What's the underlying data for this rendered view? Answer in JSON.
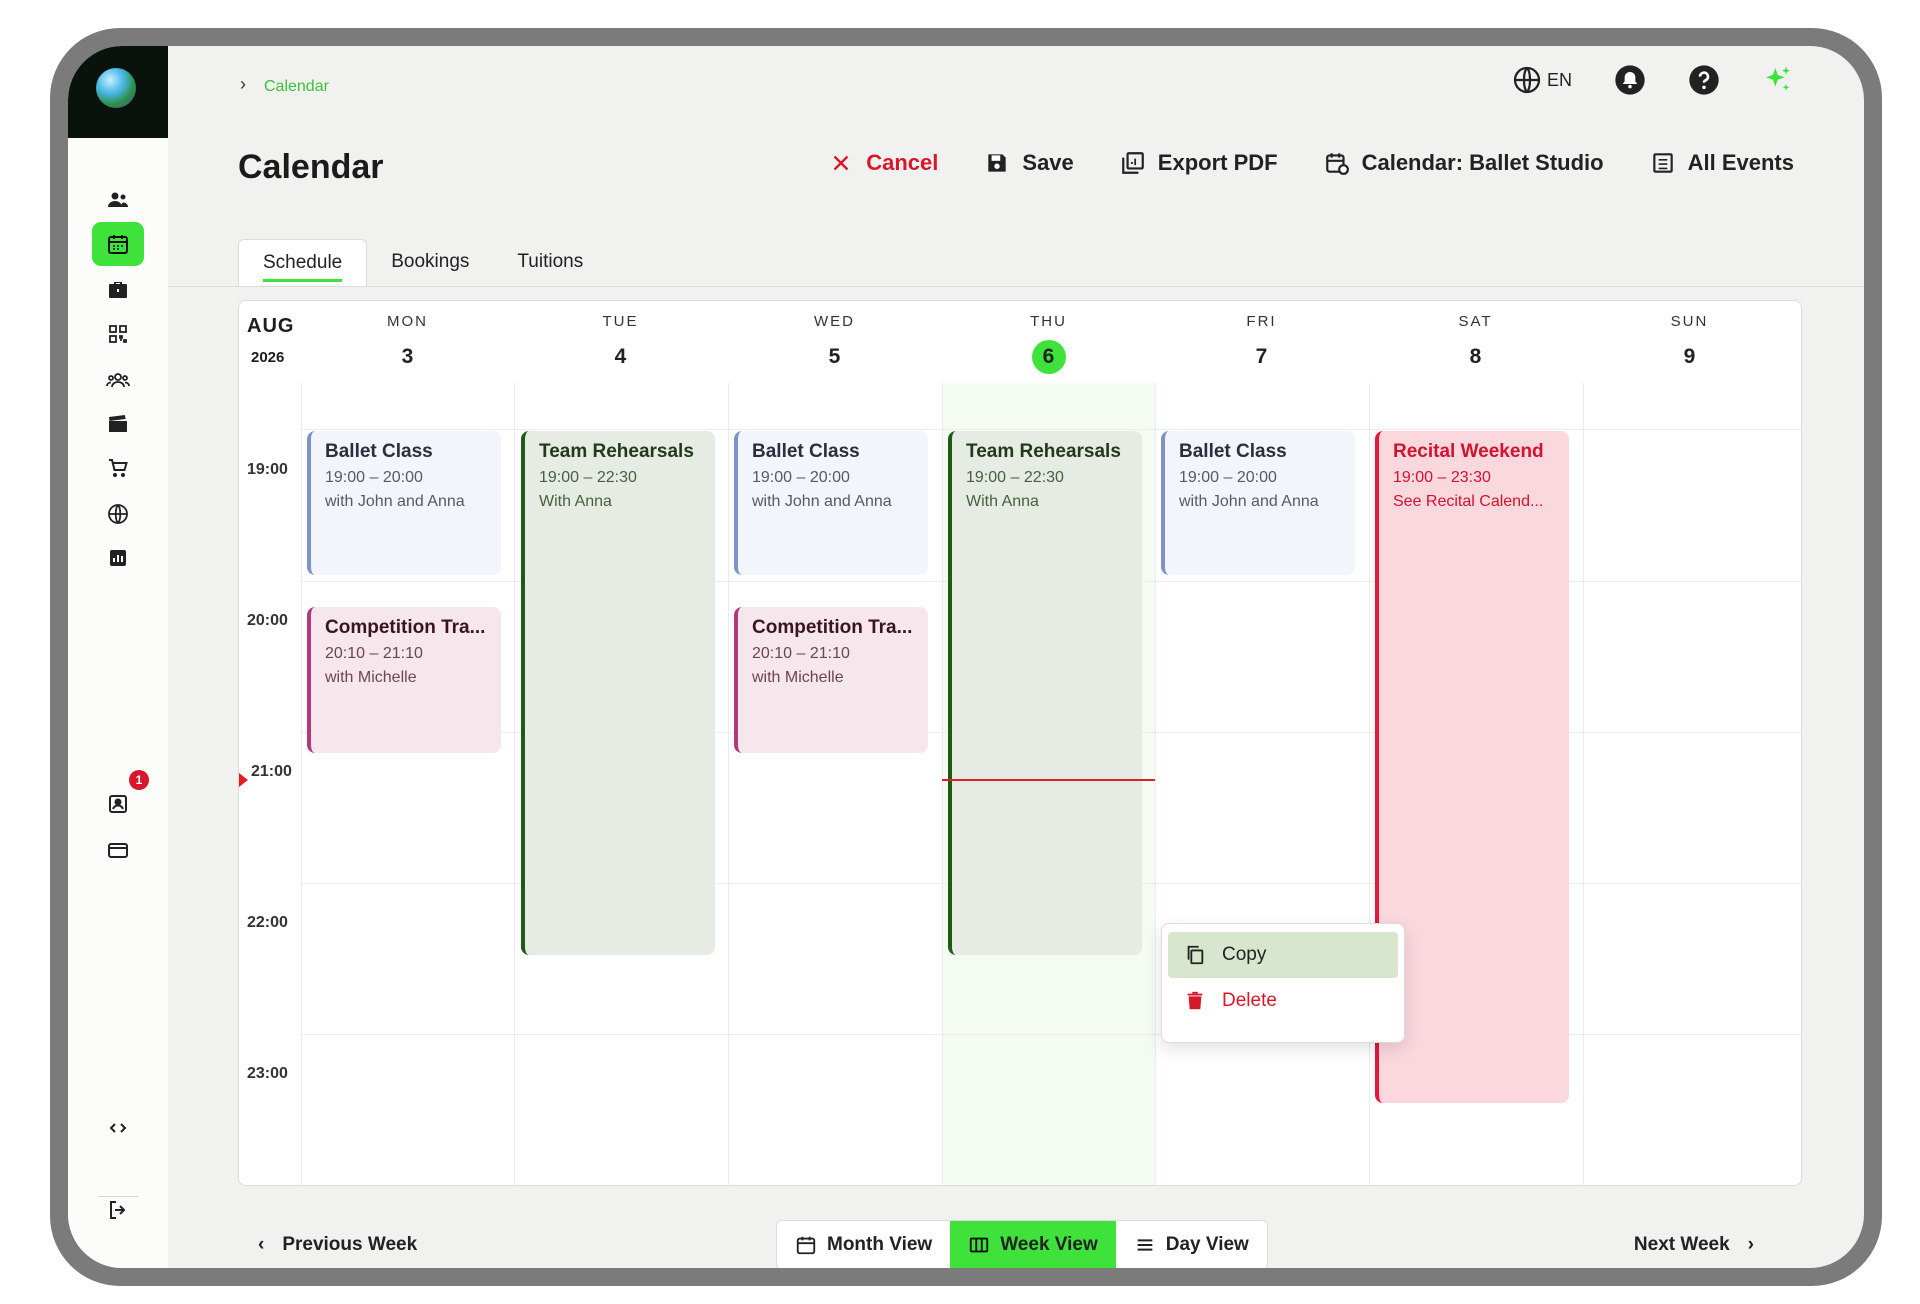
{
  "breadcrumb": {
    "current": "Calendar"
  },
  "header": {
    "title": "Calendar",
    "language": "EN",
    "actions": {
      "cancel": "Cancel",
      "save": "Save",
      "export": "Export PDF",
      "calendar": "Calendar: Ballet Studio",
      "all_events": "All Events"
    }
  },
  "tabs": [
    {
      "label": "Schedule",
      "active": true
    },
    {
      "label": "Bookings",
      "active": false
    },
    {
      "label": "Tuitions",
      "active": false
    }
  ],
  "sidebar": {
    "icons": [
      "users-icon",
      "calendar-icon",
      "briefcase-icon",
      "qr-code-icon",
      "group-icon",
      "clapperboard-icon",
      "cart-icon",
      "globe-icon",
      "report-icon",
      "contact-card-icon",
      "credit-card-icon",
      "code-icon",
      "logout-icon"
    ],
    "notification_count": "1"
  },
  "calendar": {
    "month": "AUG",
    "year": "2026",
    "days": [
      {
        "name": "MON",
        "num": "3"
      },
      {
        "name": "TUE",
        "num": "4"
      },
      {
        "name": "WED",
        "num": "5"
      },
      {
        "name": "THU",
        "num": "6",
        "today": true
      },
      {
        "name": "FRI",
        "num": "7"
      },
      {
        "name": "SAT",
        "num": "8"
      },
      {
        "name": "SUN",
        "num": "9"
      }
    ],
    "times": [
      "19:00",
      "20:00",
      "21:00",
      "22:00",
      "23:00"
    ],
    "events": {
      "mon_ballet": {
        "title": "Ballet Class",
        "time": "19:00 – 20:00",
        "note": "with John and Anna"
      },
      "mon_comp": {
        "title": "Competition Tra...",
        "time": "20:10 – 21:10",
        "note": "with Michelle"
      },
      "tue_team": {
        "title": "Team Rehearsals",
        "time": "19:00 – 22:30",
        "note": "With Anna"
      },
      "wed_ballet": {
        "title": "Ballet Class",
        "time": "19:00 – 20:00",
        "note": "with John and Anna"
      },
      "wed_comp": {
        "title": "Competition Tra...",
        "time": "20:10 – 21:10",
        "note": "with Michelle"
      },
      "thu_team": {
        "title": "Team Rehearsals",
        "time": "19:00 – 22:30",
        "note": "With Anna"
      },
      "fri_ballet": {
        "title": "Ballet Class",
        "time": "19:00 – 20:00",
        "note": "with John and Anna"
      },
      "sat_recital": {
        "title": "Recital Weekend",
        "time": "19:00 – 23:30",
        "note": "See Recital Calend..."
      }
    }
  },
  "context_menu": {
    "copy": "Copy",
    "delete": "Delete"
  },
  "footer": {
    "prev": "Previous Week",
    "next": "Next Week",
    "views": {
      "month": "Month View",
      "week": "Week View",
      "day": "Day View"
    },
    "active_view": "Week View"
  },
  "colors": {
    "accent": "#3ee23b",
    "danger": "#d6182a"
  }
}
